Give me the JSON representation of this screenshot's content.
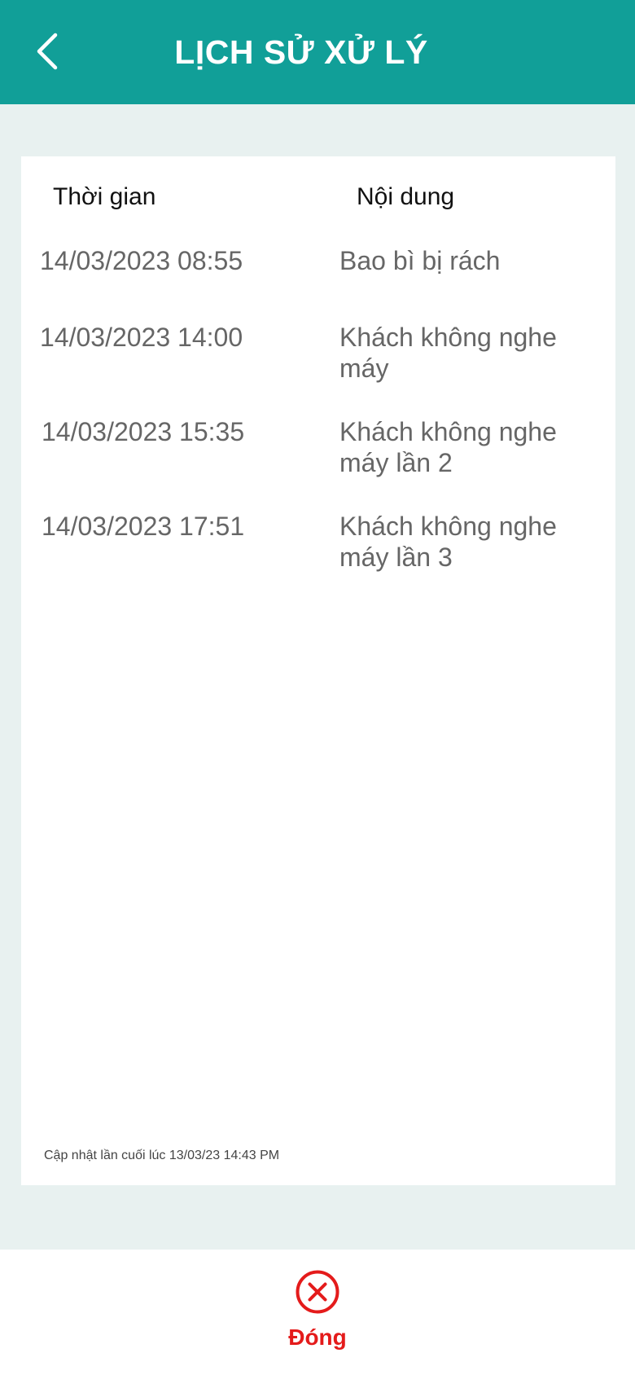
{
  "header": {
    "title": "LỊCH SỬ XỬ LÝ"
  },
  "table": {
    "col_time": "Thời gian",
    "col_content": "Nội dung",
    "rows": [
      {
        "time": "14/03/2023 08:55",
        "content": "Bao bì bị rách"
      },
      {
        "time": "14/03/2023 14:00",
        "content": "Khách không nghe máy"
      },
      {
        "time": "14/03/2023 15:35",
        "content": "Khách không nghe máy lần 2"
      },
      {
        "time": "14/03/2023 17:51",
        "content": "Khách không nghe máy lần 3"
      }
    ]
  },
  "footnote": "Cập nhật lần cuối lúc 13/03/23 14:43 PM",
  "bottom": {
    "close_label": "Đóng"
  },
  "colors": {
    "header_bg": "#119f98",
    "page_bg": "#e8f1f0",
    "close_red": "#e41b1b"
  },
  "icons": {
    "back": "chevron-left-icon",
    "close": "close-circle-icon"
  }
}
